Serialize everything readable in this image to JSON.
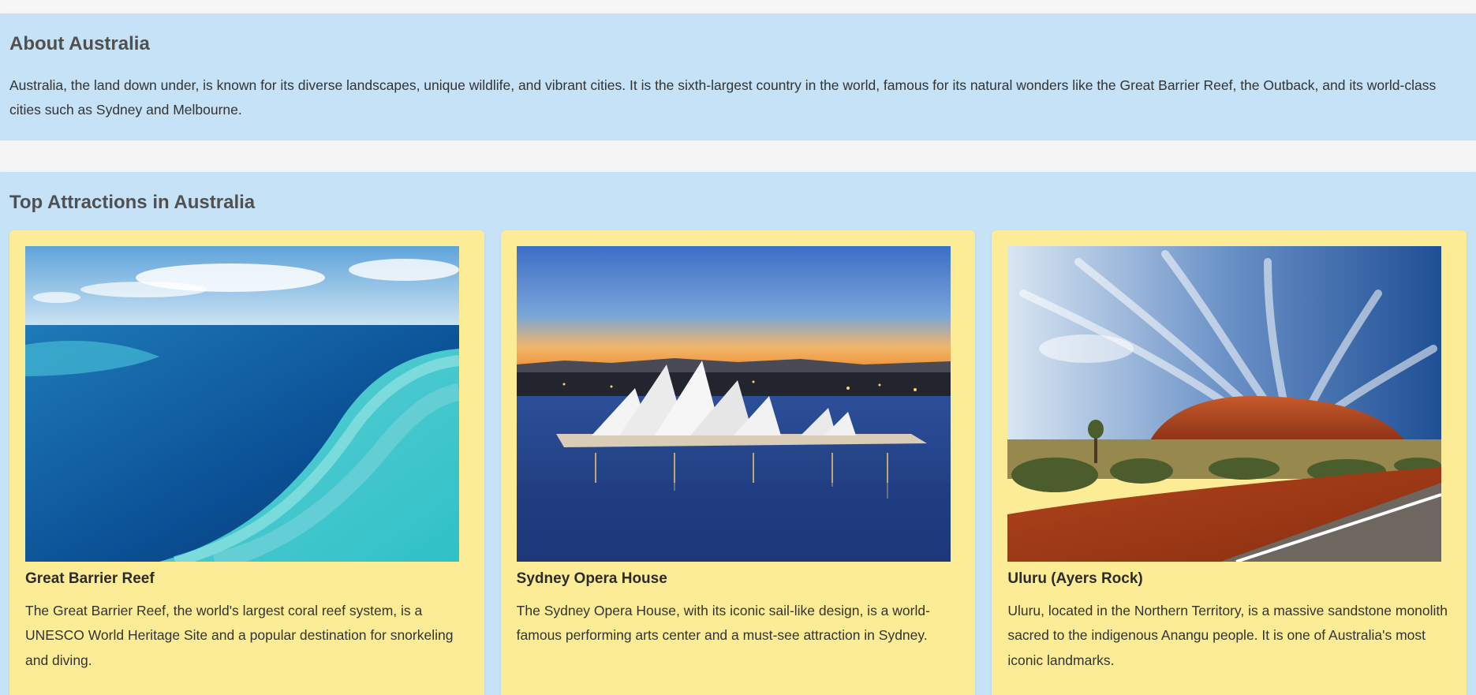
{
  "about": {
    "title": "About Australia",
    "text": "Australia, the land down under, is known for its diverse landscapes, unique wildlife, and vibrant cities. It is the sixth-largest country in the world, famous for its natural wonders like the Great Barrier Reef, the Outback, and its world-class cities such as Sydney and Melbourne."
  },
  "attractions": {
    "title": "Top Attractions in Australia",
    "cards": [
      {
        "name": "Great Barrier Reef",
        "description": "The Great Barrier Reef, the world's largest coral reef system, is a UNESCO World Heritage Site and a popular destination for snorkeling and diving."
      },
      {
        "name": "Sydney Opera House",
        "description": "The Sydney Opera House, with its iconic sail-like design, is a world-famous performing arts center and a must-see attraction in Sydney."
      },
      {
        "name": "Uluru (Ayers Rock)",
        "description": "Uluru, located in the Northern Territory, is a massive sandstone monolith sacred to the indigenous Anangu people. It is one of Australia's most iconic landmarks."
      }
    ]
  },
  "colors": {
    "panel_background": "#c6e2f6",
    "card_background": "#fcec96",
    "heading_text": "#505050"
  }
}
